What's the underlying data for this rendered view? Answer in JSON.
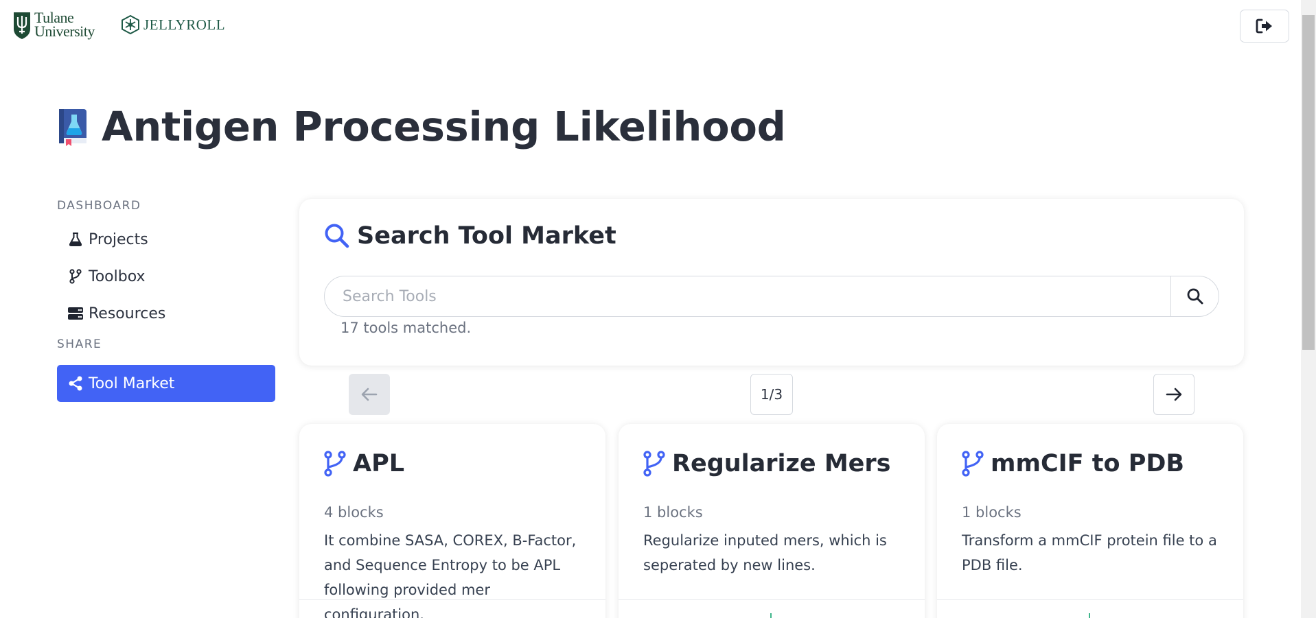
{
  "header": {
    "tulane_logo_text": [
      "Tulane",
      "University"
    ],
    "jellyroll_logo_text": "JELLYROLL",
    "logout_icon": "sign-out-icon"
  },
  "page": {
    "title": "Antigen Processing Likelihood",
    "title_icon": "flask-book-icon"
  },
  "sidebar": {
    "sections": [
      {
        "label": "DASHBOARD",
        "items": [
          {
            "label": "Projects",
            "icon": "flask-icon"
          },
          {
            "label": "Toolbox",
            "icon": "code-branch-icon"
          },
          {
            "label": "Resources",
            "icon": "server-icon"
          }
        ]
      },
      {
        "label": "SHARE",
        "items": [
          {
            "label": "Tool Market",
            "icon": "share-nodes-icon",
            "active": true
          }
        ]
      }
    ]
  },
  "search": {
    "title": "Search Tool Market",
    "placeholder": "Search Tools",
    "value": "",
    "match_text": "17 tools matched."
  },
  "pagination": {
    "indicator": "1/3",
    "prev_enabled": false,
    "next_enabled": true
  },
  "tools": [
    {
      "name": "APL",
      "blocks": "4 blocks",
      "description": "It combine SASA, COREX, B-Factor, and Sequence Entropy to be APL following provided mer configuration."
    },
    {
      "name": "Regularize Mers",
      "blocks": "1 blocks",
      "description": "Regularize inputed mers, which is seperated by new lines."
    },
    {
      "name": "mmCIF to PDB",
      "blocks": "1 blocks",
      "description": "Transform a mmCIF protein file to a PDB file."
    }
  ],
  "colors": {
    "accent": "#4263f5",
    "title_text": "#2a2f3b",
    "muted_text": "#6b7280",
    "tulane_green": "#1e4a34"
  }
}
